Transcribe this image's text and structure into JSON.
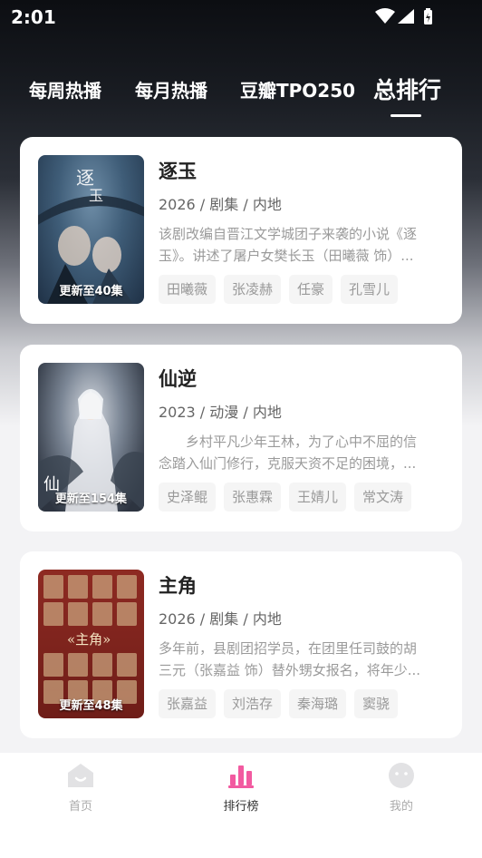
{
  "status_bar": {
    "time": "2:01"
  },
  "tabs": [
    {
      "label": "每周热播",
      "active": false
    },
    {
      "label": "每月热播",
      "active": false
    },
    {
      "label": "豆瓣TPO250",
      "active": false
    },
    {
      "label": "总排行",
      "active": true
    }
  ],
  "cards": [
    {
      "title": "逐玉",
      "meta": "2026 / 剧集 / 内地",
      "desc_line1": "该剧改编自晋江文学城团子来袭的小说《逐",
      "desc_line2": "玉》。讲述了屠户女樊长玉（田曦薇 饰）...",
      "badge": "更新至40集",
      "cast": [
        "田曦薇",
        "张凌赫",
        "任豪",
        "孔雪儿"
      ]
    },
    {
      "title": "仙逆",
      "meta": "2023 / 动漫 / 内地",
      "desc_line1": "　　乡村平凡少年王林，为了心中不屈的信",
      "desc_line2": "念踏入仙门修行，克服天资不足的困境，...",
      "badge": "更新至154集",
      "cast": [
        "史泽鲲",
        "张惠霖",
        "王婧儿",
        "常文涛"
      ]
    },
    {
      "title": "主角",
      "meta": "2026 / 剧集 / 内地",
      "desc_line1": "多年前，县剧团招学员，在团里任司鼓的胡",
      "desc_line2": "三元（张嘉益 饰）替外甥女报名，将年少...",
      "badge": "更新至48集",
      "cast": [
        "张嘉益",
        "刘浩存",
        "秦海璐",
        "窦骁"
      ]
    }
  ],
  "bottom_nav": [
    {
      "label": "首页",
      "icon": "home-icon"
    },
    {
      "label": "排行榜",
      "icon": "ranking-icon",
      "active": true
    },
    {
      "label": "我的",
      "icon": "profile-icon"
    }
  ],
  "colors": {
    "accent": "#f25aa0"
  }
}
